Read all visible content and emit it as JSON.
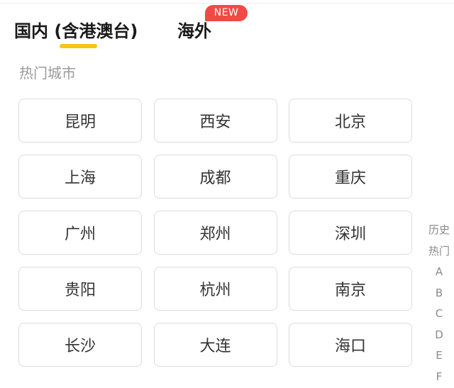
{
  "tabs": {
    "domestic_label": "国内 (含港澳台)",
    "overseas_label": "海外",
    "overseas_badge": "NEW"
  },
  "hot_cities": {
    "title": "热门城市",
    "cities": [
      "昆明",
      "西安",
      "北京",
      "上海",
      "成都",
      "重庆",
      "广州",
      "郑州",
      "深圳",
      "贵阳",
      "杭州",
      "南京",
      "长沙",
      "大连",
      "海口"
    ]
  },
  "index_bar": {
    "items": [
      "历史",
      "热门",
      "A",
      "B",
      "C",
      "D",
      "E",
      "F"
    ]
  },
  "colors": {
    "accent_underline": "#f5c518",
    "badge_bg": "#f04a45",
    "section_title": "#9a9a9a",
    "button_border": "#dcdcdc"
  }
}
